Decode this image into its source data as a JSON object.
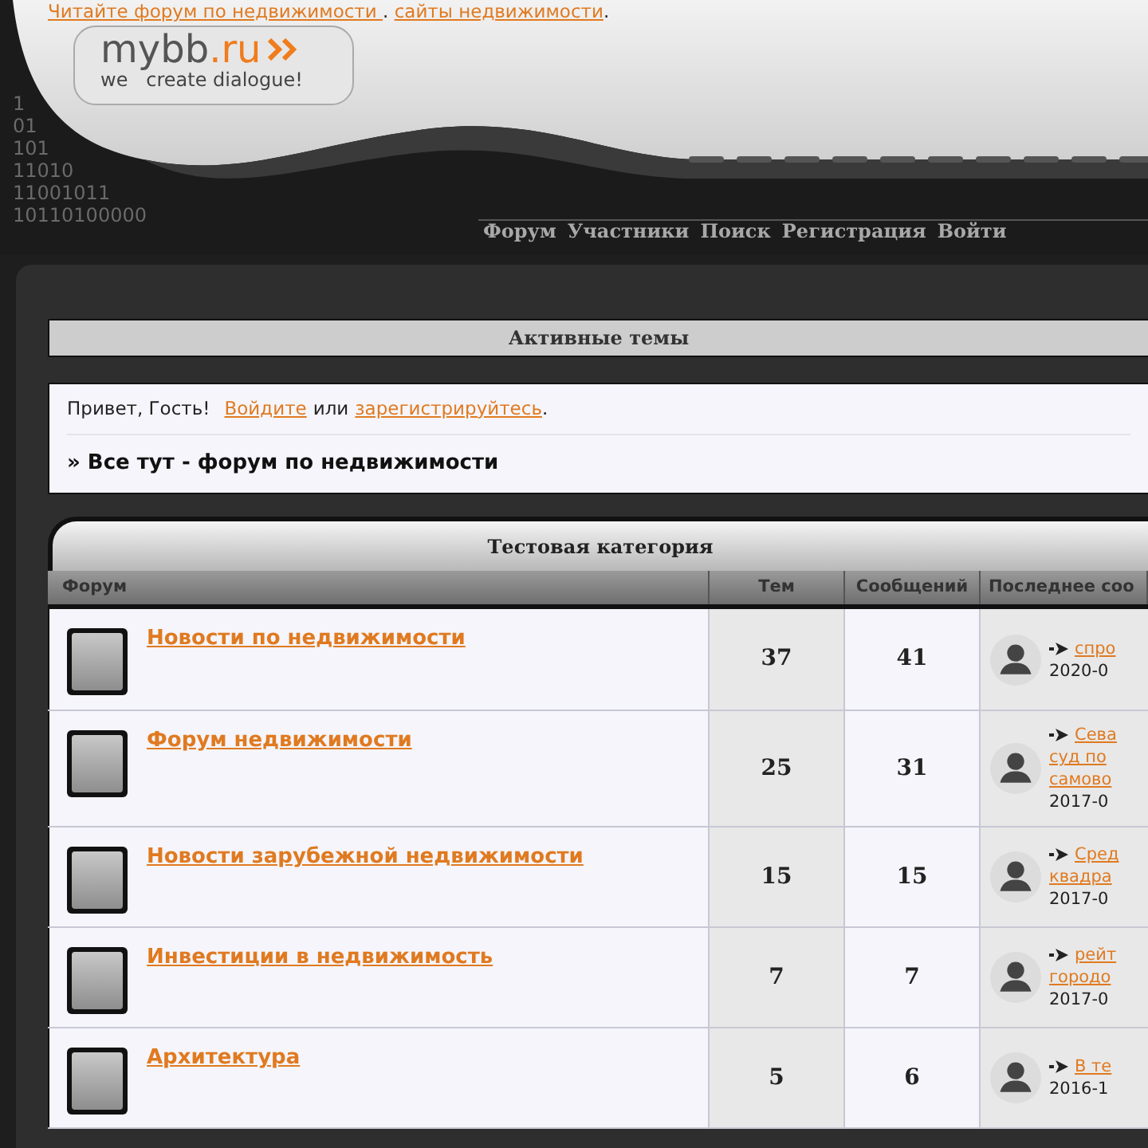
{
  "top_links": [
    {
      "text": "Читайте форум по недвижимости "
    },
    {
      "text": "сайты недвижимости"
    }
  ],
  "top_separator": ".",
  "top_end": ".",
  "logo": {
    "name": "mybb",
    "accent": ".ru",
    "tagline": "we   create dialogue!"
  },
  "binary_decoration": [
    "1",
    "01",
    "101",
    "11010",
    "11001011",
    "10110100000"
  ],
  "nav": [
    "Форум",
    "Участники",
    "Поиск",
    "Регистрация",
    "Войти"
  ],
  "active_topics": "Активные темы",
  "greeting": {
    "text": "Привет, Гость!",
    "login": "Войдите",
    "or": "или",
    "register": "зарегистрируйтесь",
    "end": "."
  },
  "board_title": "» Все тут - форум по недвижимости",
  "category": {
    "title": "Тестовая категория",
    "columns": [
      "Форум",
      "Тем",
      "Сообщений",
      "Последнее соо"
    ],
    "rows": [
      {
        "name": "Новости по недвижимости",
        "topics": "37",
        "posts": "41",
        "last_lines": [
          "спро"
        ],
        "date": "2020-0"
      },
      {
        "name": "Форум недвижимости",
        "topics": "25",
        "posts": "31",
        "last_lines": [
          "Сева",
          "суд по",
          "самово"
        ],
        "date": "2017-0"
      },
      {
        "name": "Новости зарубежной недвижимости",
        "topics": "15",
        "posts": "15",
        "last_lines": [
          "Сред",
          "квадра"
        ],
        "date": "2017-0"
      },
      {
        "name": "Инвестиции в недвижимость",
        "topics": "7",
        "posts": "7",
        "last_lines": [
          "рейт",
          "городо"
        ],
        "date": "2017-0"
      },
      {
        "name": "Архитектура",
        "topics": "5",
        "posts": "6",
        "last_lines": [
          "В те"
        ],
        "date": "2016-1"
      }
    ]
  }
}
